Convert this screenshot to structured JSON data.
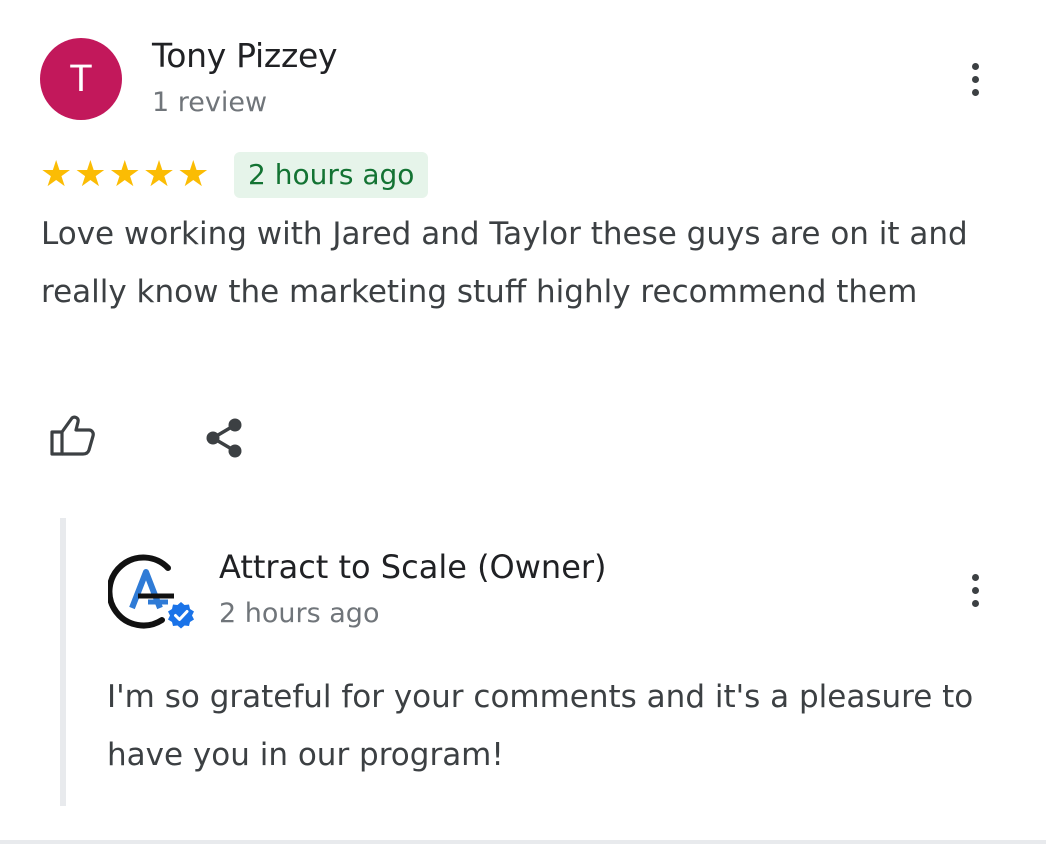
{
  "review": {
    "avatar_initial": "T",
    "avatar_color": "#c2185b",
    "reviewer_name": "Tony Pizzey",
    "review_count": "1 review",
    "rating": 5,
    "rating_max": 5,
    "time_ago": "2 hours ago",
    "text": "Love working with Jared and Taylor these guys are on it and really know the marketing stuff highly recommend them",
    "actions": [
      {
        "name": "like",
        "icon": "thumbs-up-icon"
      },
      {
        "name": "share",
        "icon": "share-icon"
      }
    ]
  },
  "owner_reply": {
    "name": "Attract to Scale (Owner)",
    "time_ago": "2 hours ago",
    "verified": true,
    "text": "I'm so grateful for your comments and it's a pleasure to have you in our program!"
  },
  "colors": {
    "star": "#fbbc04",
    "badge_bg": "#e6f4ea",
    "badge_text": "#137333",
    "verified": "#1a73e8"
  }
}
